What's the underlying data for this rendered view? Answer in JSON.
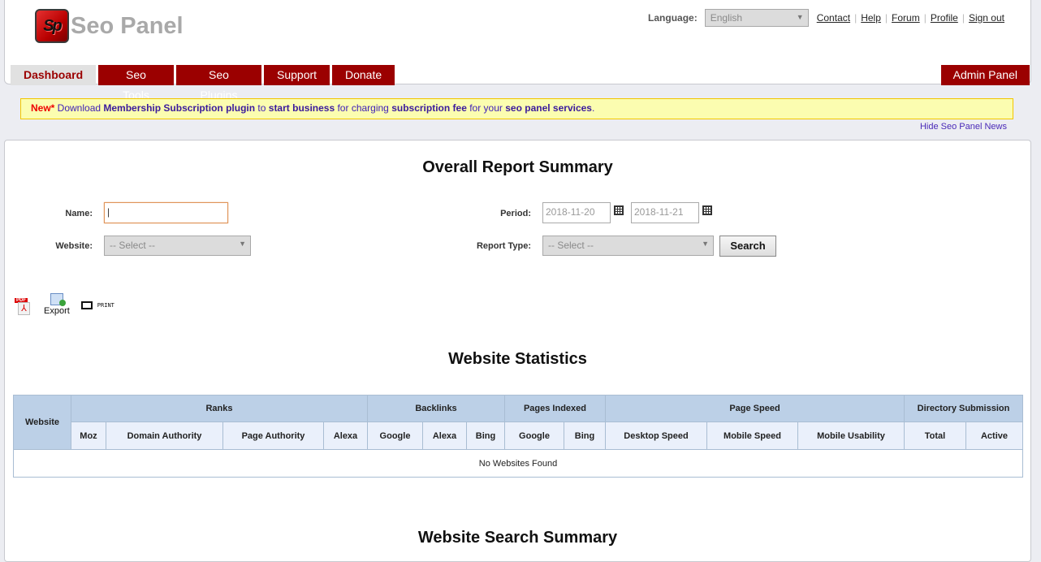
{
  "app": {
    "name": "Seo Panel",
    "logo_letters": "Sp"
  },
  "header": {
    "language_label": "Language:",
    "language_value": "English",
    "links": [
      "Contact",
      "Help",
      "Forum",
      "Profile",
      "Sign out"
    ]
  },
  "nav": {
    "items": [
      {
        "label": "Dashboard",
        "active": true
      },
      {
        "label": "Seo Tools",
        "active": false
      },
      {
        "label": "Seo Plugins",
        "active": false
      },
      {
        "label": "Support",
        "active": false
      },
      {
        "label": "Donate",
        "active": false
      }
    ],
    "admin": "Admin Panel"
  },
  "news": {
    "new": "New*",
    "t1": " Download ",
    "b1": "Membership Subscription plugin",
    "t2": " to ",
    "b2": "start business",
    "t3": " for charging ",
    "b3": "subscription fee",
    "t4": " for your ",
    "b4": "seo panel services",
    "t5": ".",
    "hide": "Hide Seo Panel News"
  },
  "report": {
    "title": "Overall Report Summary",
    "name_label": "Name:",
    "name_value": "",
    "website_label": "Website:",
    "website_value": "-- Select --",
    "period_label": "Period:",
    "period_from": "2018-11-20",
    "period_to": "2018-11-21",
    "report_type_label": "Report Type:",
    "report_type_value": "-- Select --",
    "search": "Search"
  },
  "actions": {
    "pdf": "PDF",
    "export": "Export",
    "print": "PRINT"
  },
  "stats": {
    "title": "Website Statistics",
    "website_col": "Website",
    "groups": [
      "Ranks",
      "Backlinks",
      "Pages Indexed",
      "Page Speed",
      "Directory Submission"
    ],
    "columns": [
      "Moz",
      "Domain Authority",
      "Page Authority",
      "Alexa",
      "Google",
      "Alexa",
      "Bing",
      "Google",
      "Bing",
      "Desktop Speed",
      "Mobile Speed",
      "Mobile Usability",
      "Total",
      "Active"
    ],
    "empty": "No Websites Found"
  },
  "search_summary": {
    "title": "Website Search Summary"
  }
}
